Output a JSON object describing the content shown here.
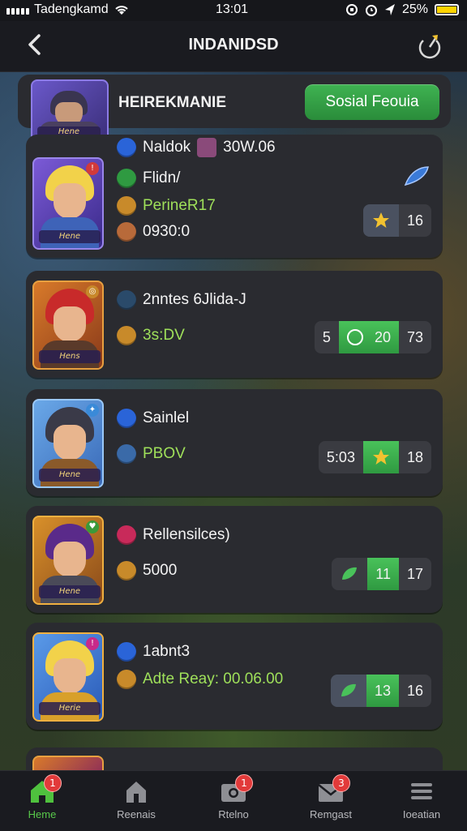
{
  "status_bar": {
    "carrier": "Tadengkamd",
    "time": "13:01",
    "battery_pct": "25%",
    "battery_color": "#ffd400"
  },
  "nav": {
    "title": "INDANIDSD",
    "back_icon": "chevron-left-icon",
    "share_icon": "share-icon"
  },
  "header": {
    "title": "HEIREKMANIE",
    "avatar_label": "Hene",
    "social_button": "Sosial Feouia"
  },
  "cards": [
    {
      "portrait_label": "Hene",
      "line1": "Naldok",
      "line1_value": "30W.06",
      "line2": "Flidn/",
      "line3": "PerineR17",
      "line4": "0930:0",
      "pill_segments": [
        "",
        "16"
      ],
      "accent": "#f2c230"
    },
    {
      "portrait_label": "Hens",
      "line1": "2nntes 6Jlida-J",
      "line2": "3s:DV",
      "pill_segments": [
        "5",
        "20",
        "73"
      ],
      "accent": "#49c25a"
    },
    {
      "portrait_label": "Hene",
      "line1": "Sainlel",
      "line2": "PBOV",
      "pill_segments": [
        "5:03",
        "",
        "18"
      ],
      "accent": "#f2c230"
    },
    {
      "portrait_label": "Hene",
      "line1": "Rellensilces)",
      "line2": "5000",
      "pill_segments": [
        "",
        "11",
        "17"
      ],
      "accent": "#49c25a"
    },
    {
      "portrait_label": "Herie",
      "line1": "1abnt3",
      "line2": "Adte Reay: 00.06.00",
      "pill_segments": [
        "",
        "13",
        "16"
      ],
      "accent": "#49c25a"
    }
  ],
  "tabs": [
    {
      "label": "Heme",
      "icon": "home-icon",
      "badge": "1"
    },
    {
      "label": "Reenais",
      "icon": "house-icon",
      "badge": ""
    },
    {
      "label": "Rtelno",
      "icon": "camera-icon",
      "badge": "1"
    },
    {
      "label": "Remgast",
      "icon": "mail-icon",
      "badge": "3"
    },
    {
      "label": "Ioeatian",
      "icon": "menu-icon",
      "badge": ""
    }
  ]
}
